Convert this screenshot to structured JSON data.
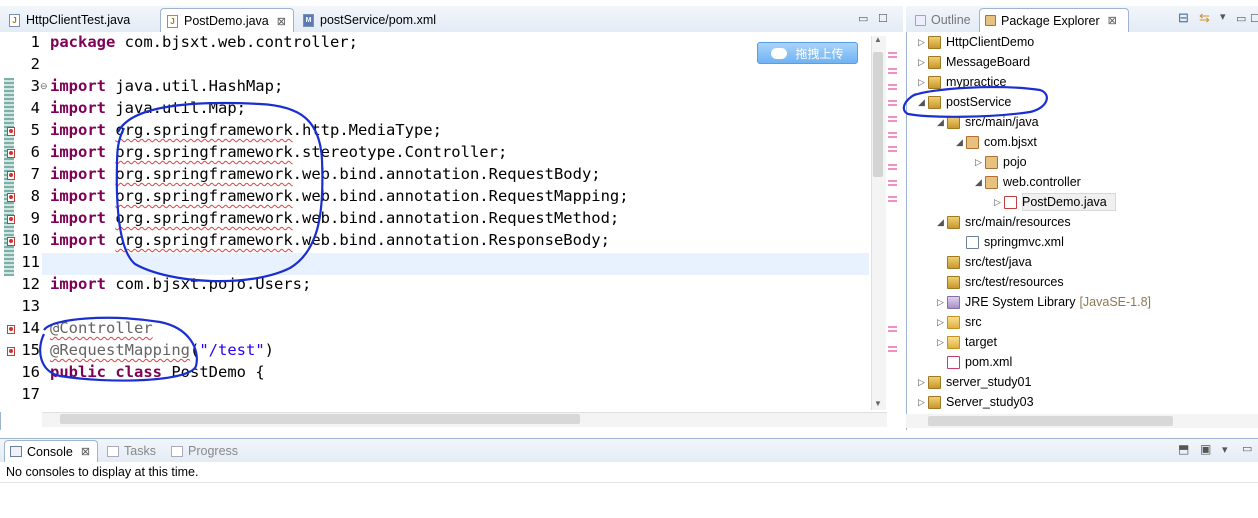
{
  "editor": {
    "tabs": [
      {
        "label": "HttpClientTest.java",
        "icon": "java-file-icon",
        "active": false
      },
      {
        "label": "PostDemo.java",
        "icon": "java-file-icon",
        "active": true,
        "close": "⊠"
      },
      {
        "label": "postService/pom.xml",
        "icon": "maven-pom-icon",
        "active": false
      }
    ],
    "upload_button": "拖拽上传",
    "lines": [
      {
        "n": "1",
        "segments": [
          [
            "kw",
            "package"
          ],
          [
            "t",
            " com.bjsxt.web.controller;"
          ]
        ]
      },
      {
        "n": "2",
        "segments": []
      },
      {
        "n": "3",
        "segments": [
          [
            "kw",
            "import"
          ],
          [
            "t",
            " java.util.HashMap;"
          ]
        ]
      },
      {
        "n": "4",
        "segments": [
          [
            "kw",
            "import"
          ],
          [
            "t",
            " java.util.Map;"
          ]
        ]
      },
      {
        "n": "5",
        "segments": [
          [
            "kw",
            "import"
          ],
          [
            "t",
            " "
          ],
          [
            "sq",
            "org.springframework"
          ],
          [
            "t",
            ".http.MediaType;"
          ]
        ]
      },
      {
        "n": "6",
        "segments": [
          [
            "kw",
            "import"
          ],
          [
            "t",
            " "
          ],
          [
            "sq",
            "org.springframework"
          ],
          [
            "t",
            ".stereotype.Controller;"
          ]
        ]
      },
      {
        "n": "7",
        "segments": [
          [
            "kw",
            "import"
          ],
          [
            "t",
            " "
          ],
          [
            "sq",
            "org.springframework"
          ],
          [
            "t",
            ".web.bind.annotation.RequestBody;"
          ]
        ]
      },
      {
        "n": "8",
        "segments": [
          [
            "kw",
            "import"
          ],
          [
            "t",
            " "
          ],
          [
            "sq",
            "org.springframework"
          ],
          [
            "t",
            ".web.bind.annotation.RequestMapping;"
          ]
        ]
      },
      {
        "n": "9",
        "segments": [
          [
            "kw",
            "import"
          ],
          [
            "t",
            " "
          ],
          [
            "sq",
            "org.springframework"
          ],
          [
            "t",
            ".web.bind.annotation.RequestMethod;"
          ]
        ]
      },
      {
        "n": "10",
        "segments": [
          [
            "kw",
            "import"
          ],
          [
            "t",
            " "
          ],
          [
            "sq",
            "org.springframework"
          ],
          [
            "t",
            ".web.bind.annotation.ResponseBody;"
          ]
        ]
      },
      {
        "n": "11",
        "segments": []
      },
      {
        "n": "12",
        "segments": [
          [
            "kw",
            "import"
          ],
          [
            "t",
            " com.bjsxt.pojo.Users;"
          ]
        ]
      },
      {
        "n": "13",
        "segments": []
      },
      {
        "n": "14",
        "segments": [
          [
            "sqa",
            "@Controller"
          ]
        ]
      },
      {
        "n": "15",
        "segments": [
          [
            "sqa",
            "@RequestMapping"
          ],
          [
            "t",
            "("
          ],
          [
            "str",
            "\"/test\""
          ],
          [
            "t",
            ")"
          ]
        ]
      },
      {
        "n": "16",
        "segments": [
          [
            "kw",
            "public"
          ],
          [
            "t",
            " "
          ],
          [
            "kw",
            "class"
          ],
          [
            "t",
            " PostDemo {"
          ]
        ]
      },
      {
        "n": "17",
        "segments": []
      }
    ]
  },
  "explorer": {
    "tabs": [
      {
        "label": "Outline",
        "active": false
      },
      {
        "label": "Package Explorer",
        "active": true
      }
    ],
    "tree": [
      {
        "label": "HttpClientDemo",
        "depth": 0,
        "tri": "▷",
        "icon": "project-icon"
      },
      {
        "label": "MessageBoard",
        "depth": 0,
        "tri": "▷",
        "icon": "project-icon"
      },
      {
        "label": "mypractice",
        "depth": 0,
        "tri": "▷",
        "icon": "project-icon"
      },
      {
        "label": "postService",
        "depth": 0,
        "tri": "◢",
        "icon": "project-error-icon"
      },
      {
        "label": "src/main/java",
        "depth": 1,
        "tri": "◢",
        "icon": "source-folder-icon"
      },
      {
        "label": "com.bjsxt",
        "depth": 2,
        "tri": "◢",
        "icon": "package-icon"
      },
      {
        "label": "pojo",
        "depth": 3,
        "tri": "▷",
        "icon": "package-icon"
      },
      {
        "label": "web.controller",
        "depth": 3,
        "tri": "◢",
        "icon": "package-icon"
      },
      {
        "label": "PostDemo.java",
        "depth": 4,
        "tri": "▷",
        "icon": "java-file-icon"
      },
      {
        "label": "src/main/resources",
        "depth": 1,
        "tri": "◢",
        "icon": "source-folder-icon"
      },
      {
        "label": "springmvc.xml",
        "depth": 2,
        "tri": "",
        "icon": "xml-file-icon"
      },
      {
        "label": "src/test/java",
        "depth": 1,
        "tri": "",
        "icon": "source-folder-icon"
      },
      {
        "label": "src/test/resources",
        "depth": 1,
        "tri": "",
        "icon": "source-folder-icon"
      },
      {
        "label": "JRE System Library",
        "depth": 1,
        "tri": "▷",
        "icon": "library-icon",
        "extra": "[JavaSE-1.8]"
      },
      {
        "label": "src",
        "depth": 1,
        "tri": "▷",
        "icon": "folder-icon"
      },
      {
        "label": "target",
        "depth": 1,
        "tri": "▷",
        "icon": "folder-icon"
      },
      {
        "label": "pom.xml",
        "depth": 1,
        "tri": "",
        "icon": "maven-pom-icon"
      },
      {
        "label": "server_study01",
        "depth": 0,
        "tri": "▷",
        "icon": "project-icon"
      },
      {
        "label": "Server_study03",
        "depth": 0,
        "tri": "▷",
        "icon": "project-icon"
      }
    ]
  },
  "console": {
    "tabs": [
      {
        "label": "Console",
        "active": true
      },
      {
        "label": "Tasks",
        "active": false
      },
      {
        "label": "Progress",
        "active": false
      }
    ],
    "message": "No consoles to display at this time."
  },
  "colors": {
    "keyword": "#7f0055",
    "string": "#2a00ff",
    "annotation": "#646464",
    "ink": "#1a2fd0"
  }
}
